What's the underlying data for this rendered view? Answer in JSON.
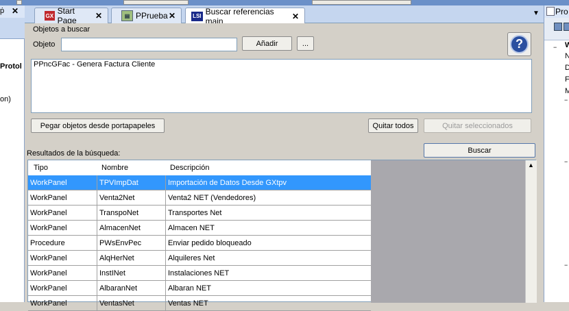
{
  "left_panel": {
    "header_glyph": "ṗ",
    "texts": [
      "Protol",
      "on)"
    ]
  },
  "right_panel": {
    "header_label": "Pro",
    "tree_nodes": [
      "W",
      "N",
      "D",
      "F",
      "M"
    ]
  },
  "tabs": [
    {
      "label": "Start Page",
      "icon": "GX"
    },
    {
      "label": "PPrueba",
      "icon": "pp"
    },
    {
      "label": "Buscar referencias main",
      "icon": "LSI",
      "active": true
    }
  ],
  "search": {
    "group_label": "Objetos a buscar",
    "object_label": "Objeto",
    "object_value": "",
    "add_button": "Añadir",
    "browse_button": "...",
    "help_glyph": "?",
    "selected_objects": [
      "PPncGFac - Genera Factura Cliente"
    ],
    "paste_button": "Pegar objetos desde portapapeles",
    "remove_all_button": "Quitar todos",
    "remove_selected_button": "Quitar seleccionados",
    "search_button": "Buscar"
  },
  "results": {
    "label": "Resultados de la búsqueda:",
    "columns": [
      "Tipo",
      "Nombre",
      "Descripción"
    ],
    "rows": [
      [
        "WorkPanel",
        "TPVImpDat",
        "Importación de Datos Desde GXtpv"
      ],
      [
        "WorkPanel",
        "Venta2Net",
        "Venta2 NET (Vendedores)"
      ],
      [
        "WorkPanel",
        "TranspoNet",
        "Transportes Net"
      ],
      [
        "WorkPanel",
        "AlmacenNet",
        "Almacen NET"
      ],
      [
        "Procedure",
        "PWsEnvPec",
        "Enviar pedido bloqueado"
      ],
      [
        "WorkPanel",
        "AlqHerNet",
        "Alquileres Net"
      ],
      [
        "WorkPanel",
        "InstINet",
        "Instalaciones NET"
      ],
      [
        "WorkPanel",
        "AlbaranNet",
        "Albaran NET"
      ],
      [
        "WorkPanel",
        "VentasNet",
        "Ventas NET"
      ]
    ],
    "selected_row": 0
  },
  "colors": {
    "selection": "#3297fd",
    "tab_strip": "#c5d6ef",
    "dialog_bg": "#d4d0c8"
  }
}
